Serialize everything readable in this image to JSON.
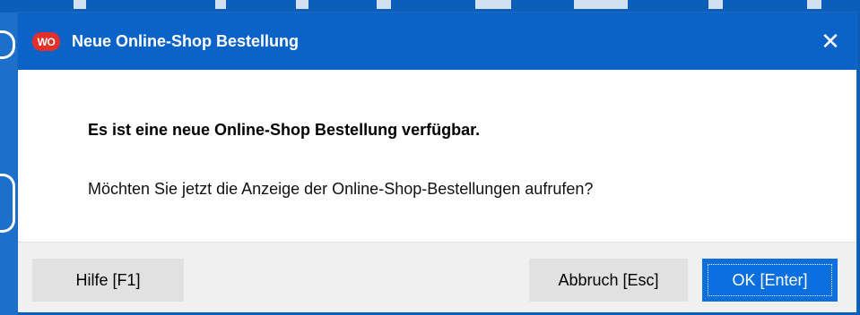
{
  "dialog": {
    "title": "Neue Online-Shop Bestellung",
    "logo_text": "WO",
    "close_glyph": "✕",
    "headline": "Es ist eine neue Online-Shop Bestellung verfügbar.",
    "message": "Möchten Sie jetzt die Anzeige der Online-Shop-Bestellungen aufrufen?"
  },
  "buttons": {
    "help": "Hilfe [F1]",
    "cancel": "Abbruch [Esc]",
    "ok": "OK [Enter]"
  },
  "colors": {
    "titlebar": "#0b63c7",
    "logo": "#e2302b",
    "ok_button": "#0b6fe0"
  },
  "icons": {
    "logo": "app-logo-icon",
    "close": "close-icon"
  }
}
